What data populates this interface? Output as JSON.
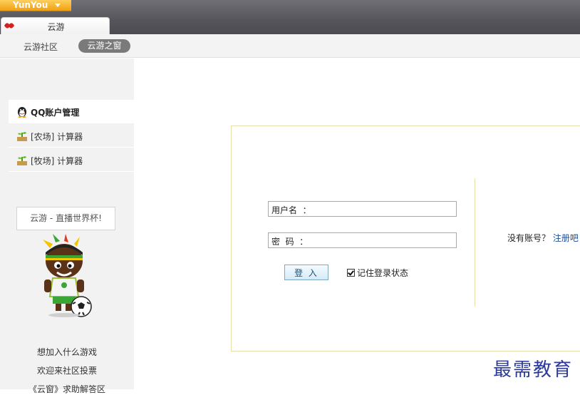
{
  "topbar": {
    "brand_label": "YunYou",
    "app_tab_label": "云游"
  },
  "subnav": {
    "community_link": "云游社区",
    "window_pill": "云游之窗"
  },
  "sidebar": {
    "items": [
      {
        "label": "QQ账户管理",
        "icon": "qq-penguin-icon",
        "active": true
      },
      {
        "label": "[农场] 计算器",
        "icon": "sprout-icon",
        "active": false
      },
      {
        "label": "[牧场] 计算器",
        "icon": "sprout-icon",
        "active": false
      }
    ],
    "promo_label": "云游 - 直播世界杯!",
    "links": [
      "想加入什么游戏",
      "欢迎来社区投票",
      "《云窗》求助解答区"
    ]
  },
  "login": {
    "username_label": "用户名  ：",
    "username_value": "",
    "password_label": "密  码  ：",
    "password_value": "",
    "login_button": "登 入",
    "remember_label": "记住登录状态",
    "remember_checked": true,
    "no_account_text": "没有账号？",
    "register_link": "注册吧"
  },
  "watermark": "最需教育",
  "colors": {
    "accent_orange": "#f0a012",
    "panel_border": "#e6dfae",
    "link_blue": "#1a4fa0"
  }
}
